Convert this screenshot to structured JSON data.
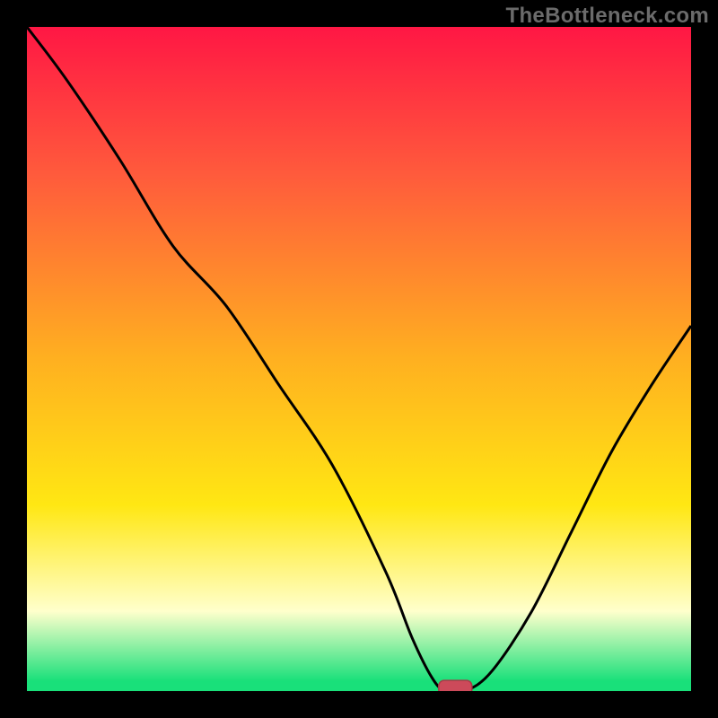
{
  "watermark": "TheBottleneck.com",
  "colors": {
    "bg": "#000000",
    "grad_top": "#ff1744",
    "grad_upper": "#ff5a3c",
    "grad_mid": "#ffb020",
    "grad_lower": "#ffe713",
    "grad_pale": "#ffffcc",
    "grad_green": "#19e07a",
    "curve": "#000000",
    "marker_fill": "#cc4a5a",
    "marker_stroke": "#a83a48"
  },
  "chart_data": {
    "type": "line",
    "title": "",
    "xlabel": "",
    "ylabel": "",
    "xlim": [
      0,
      100
    ],
    "ylim": [
      0,
      100
    ],
    "series": [
      {
        "name": "bottleneck-curve",
        "x": [
          0,
          6,
          14,
          22,
          30,
          38,
          46,
          54,
          58,
          61,
          63,
          66,
          70,
          76,
          82,
          88,
          94,
          100
        ],
        "values": [
          100,
          92,
          80,
          67,
          58,
          46,
          34,
          18,
          8,
          2,
          0,
          0,
          3,
          12,
          24,
          36,
          46,
          55
        ]
      }
    ],
    "marker": {
      "x": 64.5,
      "y": 0.5,
      "w": 5,
      "h": 2.2
    },
    "gradient_stops": [
      {
        "offset": 0.0,
        "color_key": "grad_top"
      },
      {
        "offset": 0.22,
        "color_key": "grad_upper"
      },
      {
        "offset": 0.5,
        "color_key": "grad_mid"
      },
      {
        "offset": 0.72,
        "color_key": "grad_lower"
      },
      {
        "offset": 0.88,
        "color_key": "grad_pale"
      },
      {
        "offset": 0.985,
        "color_key": "grad_green"
      },
      {
        "offset": 1.0,
        "color_key": "grad_green"
      }
    ]
  }
}
